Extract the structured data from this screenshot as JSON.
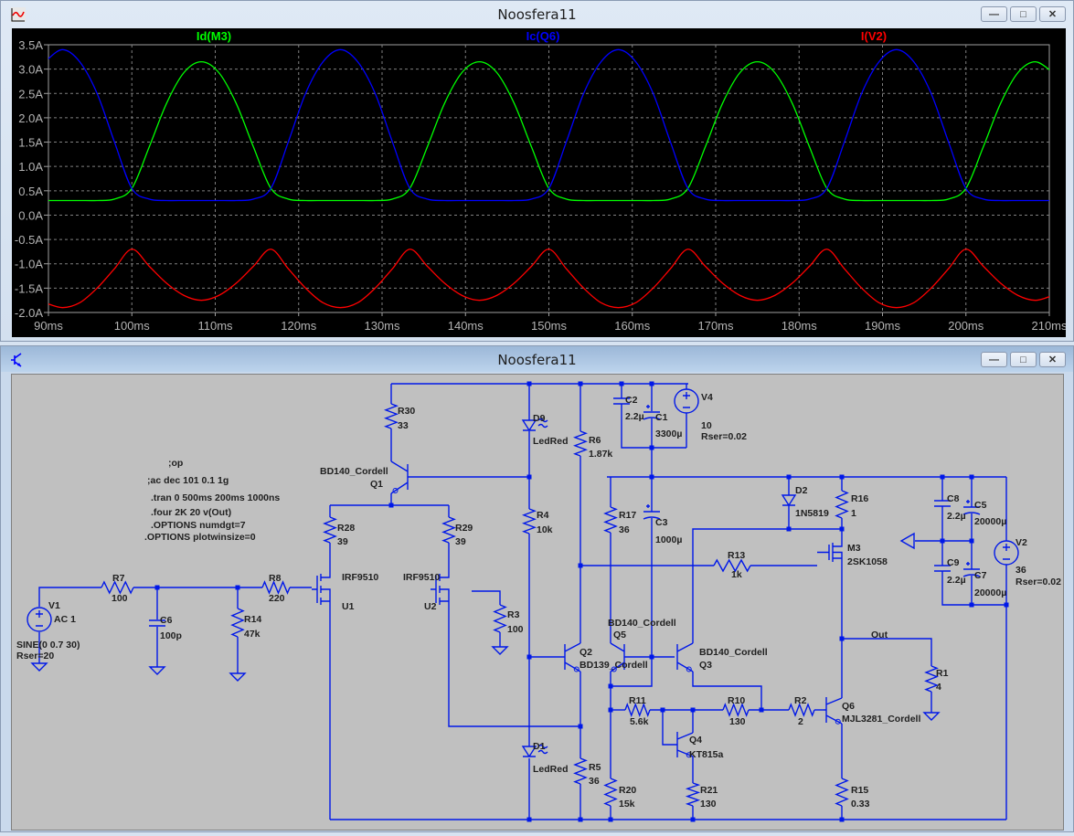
{
  "waveform_window": {
    "title": "Noosfera11",
    "icon": "waveform-icon"
  },
  "schematic_window": {
    "title": "Noosfera11",
    "icon": "transistor-icon"
  },
  "window_buttons": {
    "minimize": "minimize-icon",
    "maximize": "maximize-icon",
    "close": "close-icon"
  },
  "chart_data": {
    "type": "line",
    "title": "",
    "xlabel": "",
    "ylabel": "",
    "xlim": [
      90,
      210
    ],
    "ylim": [
      -2.0,
      3.5
    ],
    "x_unit": "ms",
    "y_unit": "A",
    "grid": true,
    "x_ticks": [
      "90ms",
      "100ms",
      "110ms",
      "120ms",
      "130ms",
      "140ms",
      "150ms",
      "160ms",
      "170ms",
      "180ms",
      "190ms",
      "200ms",
      "210ms"
    ],
    "y_ticks": [
      "3.5A",
      "3.0A",
      "2.5A",
      "2.0A",
      "1.5A",
      "1.0A",
      "0.5A",
      "0.0A",
      "-0.5A",
      "-1.0A",
      "-1.5A",
      "-2.0A"
    ],
    "x": [
      89.58,
      91.67,
      93.75,
      95.83,
      97.92,
      100,
      102.08,
      104.17,
      106.25,
      108.33,
      110.42,
      112.5,
      114.58,
      116.67,
      118.75,
      120.83,
      122.92,
      125,
      127.08,
      129.17,
      131.25,
      133.33,
      135.42,
      137.5,
      139.58,
      141.67,
      143.75,
      145.83,
      147.92,
      150,
      152.08,
      154.17,
      156.25,
      158.33,
      160.42,
      162.5,
      164.58,
      166.67,
      168.75,
      170.83,
      172.92,
      175,
      177.08,
      179.17,
      181.25,
      183.33,
      185.42,
      187.5,
      189.58,
      191.67,
      193.75,
      195.83,
      197.92,
      200,
      202.08,
      204.17,
      206.25,
      208.33,
      210.42
    ],
    "series": [
      {
        "name": "Id(M3)",
        "color": "#00ff00",
        "values": [
          0.3,
          0.3,
          0.3,
          0.3,
          0.33,
          0.55,
          1.4,
          2.3,
          2.93,
          3.15,
          2.93,
          2.3,
          1.4,
          0.55,
          0.33,
          0.3,
          0.3,
          0.3,
          0.3,
          0.3,
          0.33,
          0.55,
          1.4,
          2.3,
          2.93,
          3.15,
          2.93,
          2.3,
          1.4,
          0.55,
          0.33,
          0.3,
          0.3,
          0.3,
          0.3,
          0.3,
          0.33,
          0.55,
          1.4,
          2.3,
          2.93,
          3.15,
          2.93,
          2.3,
          1.4,
          0.55,
          0.33,
          0.3,
          0.3,
          0.3,
          0.3,
          0.3,
          0.33,
          0.55,
          1.4,
          2.3,
          2.93,
          3.15,
          2.93
        ]
      },
      {
        "name": "Ic(Q6)",
        "color": "#0000ff",
        "values": [
          3.15,
          3.4,
          3.15,
          2.5,
          1.5,
          0.55,
          0.33,
          0.3,
          0.3,
          0.3,
          0.3,
          0.3,
          0.33,
          0.55,
          1.5,
          2.5,
          3.15,
          3.4,
          3.15,
          2.5,
          1.5,
          0.55,
          0.33,
          0.3,
          0.3,
          0.3,
          0.3,
          0.3,
          0.33,
          0.55,
          1.5,
          2.5,
          3.15,
          3.4,
          3.15,
          2.5,
          1.5,
          0.55,
          0.33,
          0.3,
          0.3,
          0.3,
          0.3,
          0.3,
          0.33,
          0.55,
          1.5,
          2.5,
          3.15,
          3.4,
          3.15,
          2.5,
          1.5,
          0.55,
          0.33,
          0.3,
          0.3,
          0.3,
          0.3
        ]
      },
      {
        "name": "I(V2)",
        "color": "#ff0000",
        "values": [
          -1.8,
          -1.9,
          -1.8,
          -1.5,
          -1.1,
          -0.7,
          -1.05,
          -1.4,
          -1.65,
          -1.75,
          -1.65,
          -1.4,
          -1.05,
          -0.7,
          -1.1,
          -1.5,
          -1.8,
          -1.9,
          -1.8,
          -1.5,
          -1.1,
          -0.7,
          -1.05,
          -1.4,
          -1.65,
          -1.75,
          -1.65,
          -1.4,
          -1.05,
          -0.7,
          -1.1,
          -1.5,
          -1.8,
          -1.9,
          -1.8,
          -1.5,
          -1.1,
          -0.7,
          -1.05,
          -1.4,
          -1.65,
          -1.75,
          -1.65,
          -1.4,
          -1.05,
          -0.7,
          -1.1,
          -1.5,
          -1.8,
          -1.9,
          -1.8,
          -1.5,
          -1.1,
          -0.7,
          -1.05,
          -1.4,
          -1.65,
          -1.75,
          -1.65
        ]
      }
    ]
  },
  "schematic": {
    "directives": [
      ";op",
      ";ac dec 101 0.1 1g",
      ".tran 0 500ms 200ms 1000ns",
      ".four 2K 20 v(Out)",
      ".OPTIONS numdgt=7",
      ".OPTIONS plotwinsize=0"
    ],
    "net_labels": {
      "out": "Out"
    },
    "components": [
      {
        "ref": "V1",
        "value": "AC 1",
        "value2": "SINE(0 0.7 30)",
        "value3": "Rser=20"
      },
      {
        "ref": "R7",
        "value": "100"
      },
      {
        "ref": "C6",
        "value": "100p"
      },
      {
        "ref": "R14",
        "value": "47k"
      },
      {
        "ref": "R8",
        "value": "220"
      },
      {
        "ref": "U1",
        "value": "IRF9510"
      },
      {
        "ref": "U2",
        "value": "IRF9510"
      },
      {
        "ref": "R28",
        "value": "39"
      },
      {
        "ref": "R29",
        "value": "39"
      },
      {
        "ref": "R30",
        "value": "33"
      },
      {
        "ref": "Q1",
        "value": "BD140_Cordell"
      },
      {
        "ref": "R3",
        "value": "100"
      },
      {
        "ref": "D9",
        "value": "LedRed"
      },
      {
        "ref": "R4",
        "value": "10k"
      },
      {
        "ref": "D1",
        "value": "LedRed"
      },
      {
        "ref": "R6",
        "value": "1.87k"
      },
      {
        "ref": "R5",
        "value": "36"
      },
      {
        "ref": "Q2",
        "value": "BD139_Cordell"
      },
      {
        "ref": "C2",
        "value": "2.2µ"
      },
      {
        "ref": "C1",
        "value": "3300µ"
      },
      {
        "ref": "V4",
        "value": "10",
        "value2": "Rser=0.02"
      },
      {
        "ref": "C3",
        "value": "1000µ"
      },
      {
        "ref": "R17",
        "value": "36"
      },
      {
        "ref": "Q5",
        "value": "BD140_Cordell"
      },
      {
        "ref": "Q3",
        "value": "BD140_Cordell"
      },
      {
        "ref": "R13",
        "value": "1k"
      },
      {
        "ref": "D2",
        "value": "1N5819"
      },
      {
        "ref": "R16",
        "value": "1"
      },
      {
        "ref": "M3",
        "value": "2SK1058"
      },
      {
        "ref": "R11",
        "value": "5.6k"
      },
      {
        "ref": "R10",
        "value": "130"
      },
      {
        "ref": "R2",
        "value": "2"
      },
      {
        "ref": "Q4",
        "value": "KT815a"
      },
      {
        "ref": "R20",
        "value": "15k"
      },
      {
        "ref": "R21",
        "value": "130"
      },
      {
        "ref": "Q6",
        "value": "MJL3281_Cordell"
      },
      {
        "ref": "R15",
        "value": "0.33"
      },
      {
        "ref": "R1",
        "value": "4"
      },
      {
        "ref": "C8",
        "value": "2.2µ"
      },
      {
        "ref": "C9",
        "value": "2.2µ"
      },
      {
        "ref": "C5",
        "value": "20000µ"
      },
      {
        "ref": "C7",
        "value": "20000µ"
      },
      {
        "ref": "V2",
        "value": "36",
        "value2": "Rser=0.02"
      }
    ]
  }
}
